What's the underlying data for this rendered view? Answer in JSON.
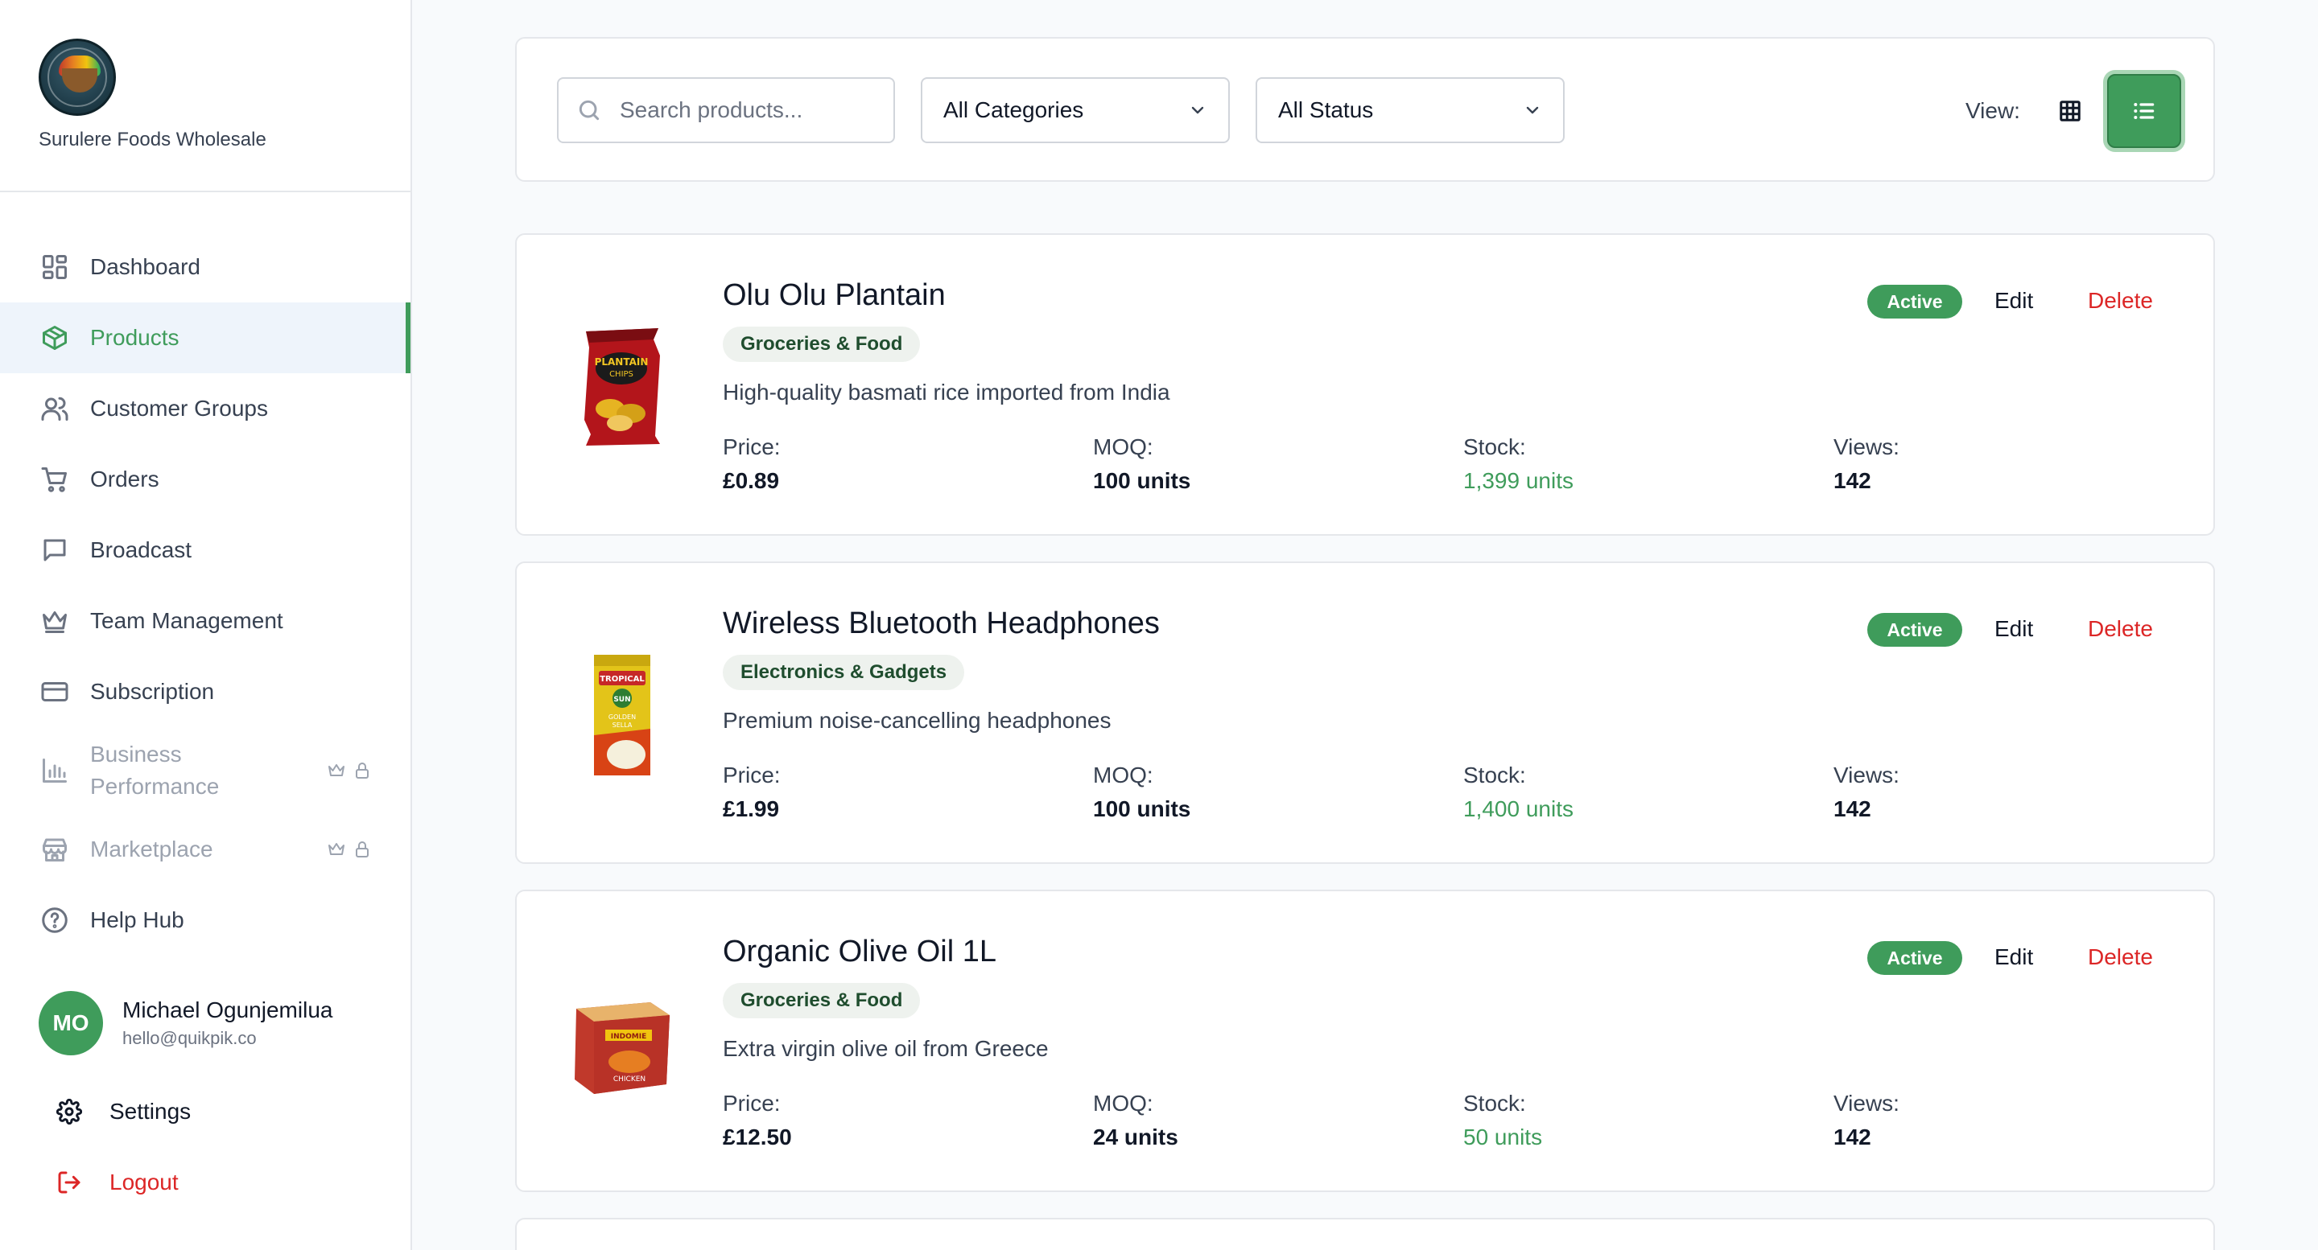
{
  "brand": {
    "name": "Surulere Foods Wholesale"
  },
  "sidebar": {
    "items": [
      {
        "label": "Dashboard",
        "icon": "dashboard-icon"
      },
      {
        "label": "Products",
        "icon": "box-icon",
        "active": true
      },
      {
        "label": "Customer Groups",
        "icon": "users-icon"
      },
      {
        "label": "Orders",
        "icon": "cart-icon"
      },
      {
        "label": "Broadcast",
        "icon": "message-icon"
      },
      {
        "label": "Team Management",
        "icon": "crown-icon"
      },
      {
        "label": "Subscription",
        "icon": "card-icon"
      },
      {
        "label": "Business Performance",
        "icon": "bar-chart-icon",
        "locked": true
      },
      {
        "label": "Marketplace",
        "icon": "store-icon",
        "locked": true
      },
      {
        "label": "Help Hub",
        "icon": "help-icon"
      }
    ]
  },
  "user": {
    "initials": "MO",
    "name": "Michael Ogunjemilua",
    "email": "hello@quikpik.co"
  },
  "bottom": {
    "settings": "Settings",
    "logout": "Logout"
  },
  "filters": {
    "search_placeholder": "Search products...",
    "category": "All Categories",
    "status": "All Status",
    "view_label": "View:"
  },
  "labels": {
    "price": "Price:",
    "moq": "MOQ:",
    "stock": "Stock:",
    "views": "Views:",
    "edit": "Edit",
    "delete": "Delete"
  },
  "products": [
    {
      "name": "Olu Olu Plantain",
      "category": "Groceries & Food",
      "description": "High-quality basmati rice imported from India",
      "price": "£0.89",
      "moq": "100 units",
      "stock": "1,399 units",
      "views": "142",
      "status": "Active"
    },
    {
      "name": "Wireless Bluetooth Headphones",
      "category": "Electronics & Gadgets",
      "description": "Premium noise-cancelling headphones",
      "price": "£1.99",
      "moq": "100 units",
      "stock": "1,400 units",
      "views": "142",
      "status": "Active"
    },
    {
      "name": "Organic Olive Oil 1L",
      "category": "Groceries & Food",
      "description": "Extra virgin olive oil from Greece",
      "price": "£12.50",
      "moq": "24 units",
      "stock": "50 units",
      "views": "142",
      "status": "Active"
    }
  ],
  "colors": {
    "accent": "#3f9c5b",
    "danger": "#dc2626",
    "active_bg": "#eef4fb"
  }
}
